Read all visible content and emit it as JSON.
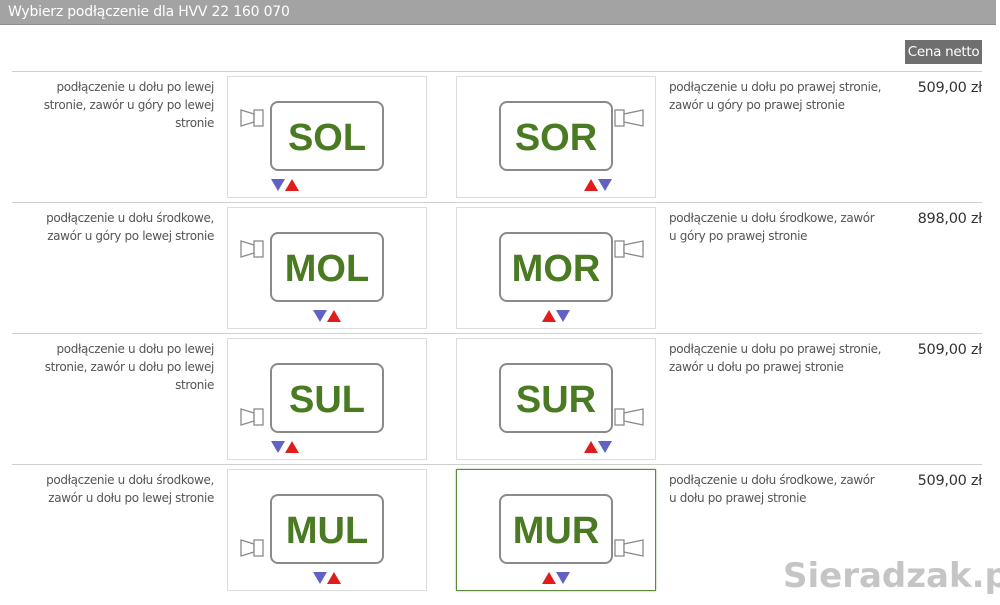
{
  "window": {
    "title": "Wybierz podłączenie dla HVV 22 160 070"
  },
  "header": {
    "price_label": "Cena netto"
  },
  "colors": {
    "code_text": "#4a7a22",
    "arrow_down": "#6262c4",
    "arrow_up": "#e01c1c",
    "selected_border": "#5d8a3c"
  },
  "rows": [
    {
      "left": {
        "code": "SOL",
        "description": "podłączenie u dołu po lewej stronie, zawór u góry po lewej stronie"
      },
      "right": {
        "code": "SOR",
        "description": "podłączenie u dołu po prawej stronie, zawór u góry po prawej stronie"
      },
      "price": "509,00 zł"
    },
    {
      "left": {
        "code": "MOL",
        "description": "podłączenie u dołu środkowe, zawór u góry po lewej stronie"
      },
      "right": {
        "code": "MOR",
        "description": "podłączenie u dołu środkowe, zawór u góry po prawej stronie"
      },
      "price": "898,00 zł"
    },
    {
      "left": {
        "code": "SUL",
        "description": "podłączenie u dołu po lewej stronie, zawór u dołu po lewej stronie"
      },
      "right": {
        "code": "SUR",
        "description": "podłączenie u dołu po prawej stronie, zawór u dołu po prawej stronie"
      },
      "price": "509,00 zł"
    },
    {
      "left": {
        "code": "MUL",
        "description": "podłączenie u dołu środkowe, zawór u dołu po lewej stronie"
      },
      "right": {
        "code": "MUR",
        "description": "podłączenie u dołu środkowe, zawór u dołu po prawej stronie"
      },
      "price": "509,00 zł"
    }
  ],
  "selected_option": "MUR",
  "watermark": "Sieradzak.pl"
}
